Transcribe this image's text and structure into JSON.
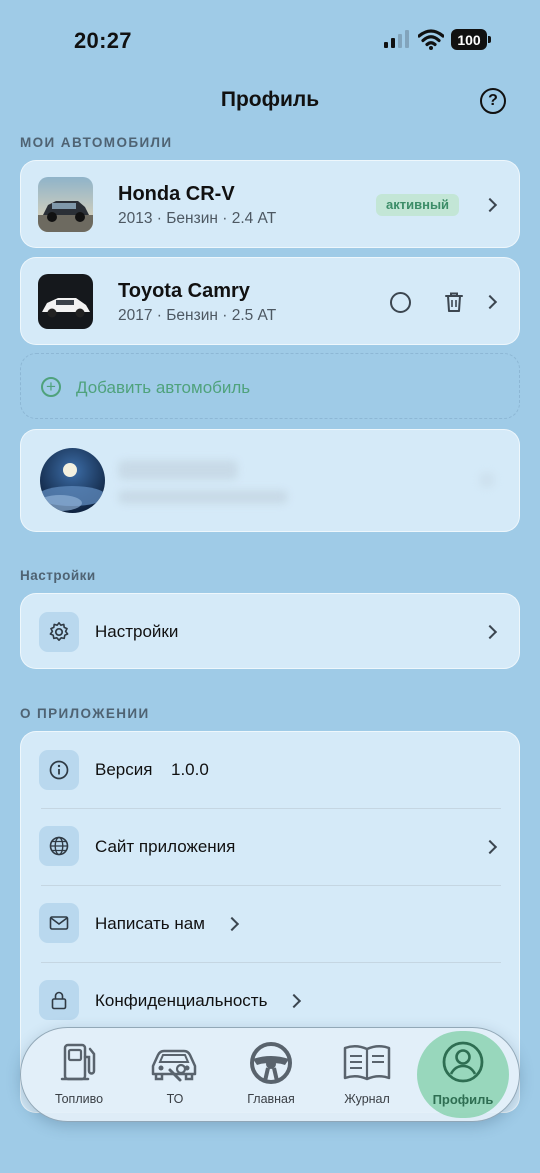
{
  "status": {
    "time": "20:27",
    "battery": "100"
  },
  "header": {
    "title": "Профиль",
    "help_icon": "?"
  },
  "sections": {
    "cars": "МОИ АВТОМОБИЛИ",
    "settings": "Настройки",
    "about": "О ПРИЛОЖЕНИИ"
  },
  "cars": [
    {
      "name": "Honda CR-V",
      "details": "2013 · Бензин · 2.4 AT",
      "badge": "активный"
    },
    {
      "name": "Toyota Camry",
      "details": "2017 · Бензин · 2.5 AT"
    }
  ],
  "add_car": {
    "label": "Добавить автомобиль"
  },
  "settings": {
    "item": "Настройки"
  },
  "about": {
    "version_label": "Версия",
    "version_value": "1.0.0",
    "site": "Сайт приложения",
    "write": "Написать нам",
    "privacy": "Конфиденциальность"
  },
  "tabs": [
    {
      "label": "Топливо",
      "icon": "fuel-pump-icon"
    },
    {
      "label": "ТО",
      "icon": "car-service-icon"
    },
    {
      "label": "Главная",
      "icon": "steering-wheel-icon"
    },
    {
      "label": "Журнал",
      "icon": "journal-icon"
    },
    {
      "label": "Профиль",
      "icon": "profile-icon"
    }
  ],
  "colors": {
    "background": "#9fcbe7",
    "accent_green": "#4fa27c",
    "badge_bg": "#c3e6d6"
  }
}
